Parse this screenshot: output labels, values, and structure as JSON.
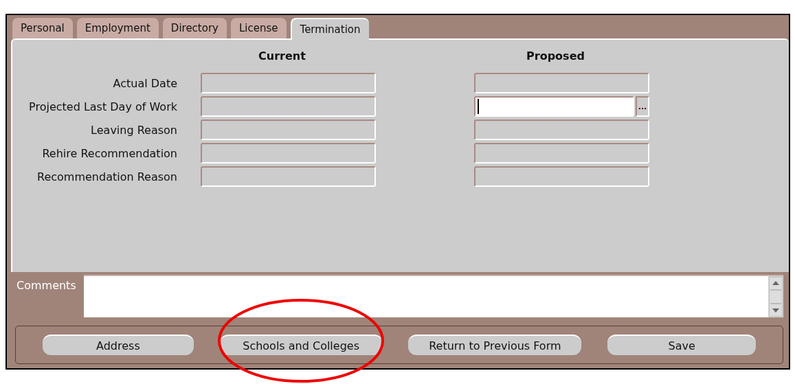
{
  "tabs": [
    {
      "label": "Personal",
      "selected": false
    },
    {
      "label": "Employment",
      "selected": false
    },
    {
      "label": "Directory",
      "selected": false
    },
    {
      "label": "License",
      "selected": false
    },
    {
      "label": "Termination",
      "selected": true
    }
  ],
  "columns": [
    "Current",
    "Proposed"
  ],
  "rows": [
    {
      "label": "Actual Date",
      "current": {
        "focused": false
      },
      "proposed": {
        "focused": false
      }
    },
    {
      "label": "Projected Last Day of Work",
      "current": {
        "focused": false
      },
      "proposed": {
        "focused": true,
        "lov_button": "..."
      }
    },
    {
      "label": "Leaving Reason",
      "current": {
        "focused": false
      },
      "proposed": {
        "focused": false
      }
    },
    {
      "label": "Rehire Recommendation",
      "current": {
        "focused": false
      },
      "proposed": {
        "focused": false
      }
    },
    {
      "label": "Recommendation Reason",
      "current": {
        "focused": false
      },
      "proposed": {
        "focused": false
      }
    }
  ],
  "comments": {
    "label": "Comments"
  },
  "buttons": [
    {
      "label": "Address",
      "highlighted": false
    },
    {
      "label": "Schools and Colleges",
      "highlighted": true
    },
    {
      "label": "Return to Previous Form",
      "highlighted": false
    },
    {
      "label": "Save",
      "highlighted": false
    }
  ]
}
